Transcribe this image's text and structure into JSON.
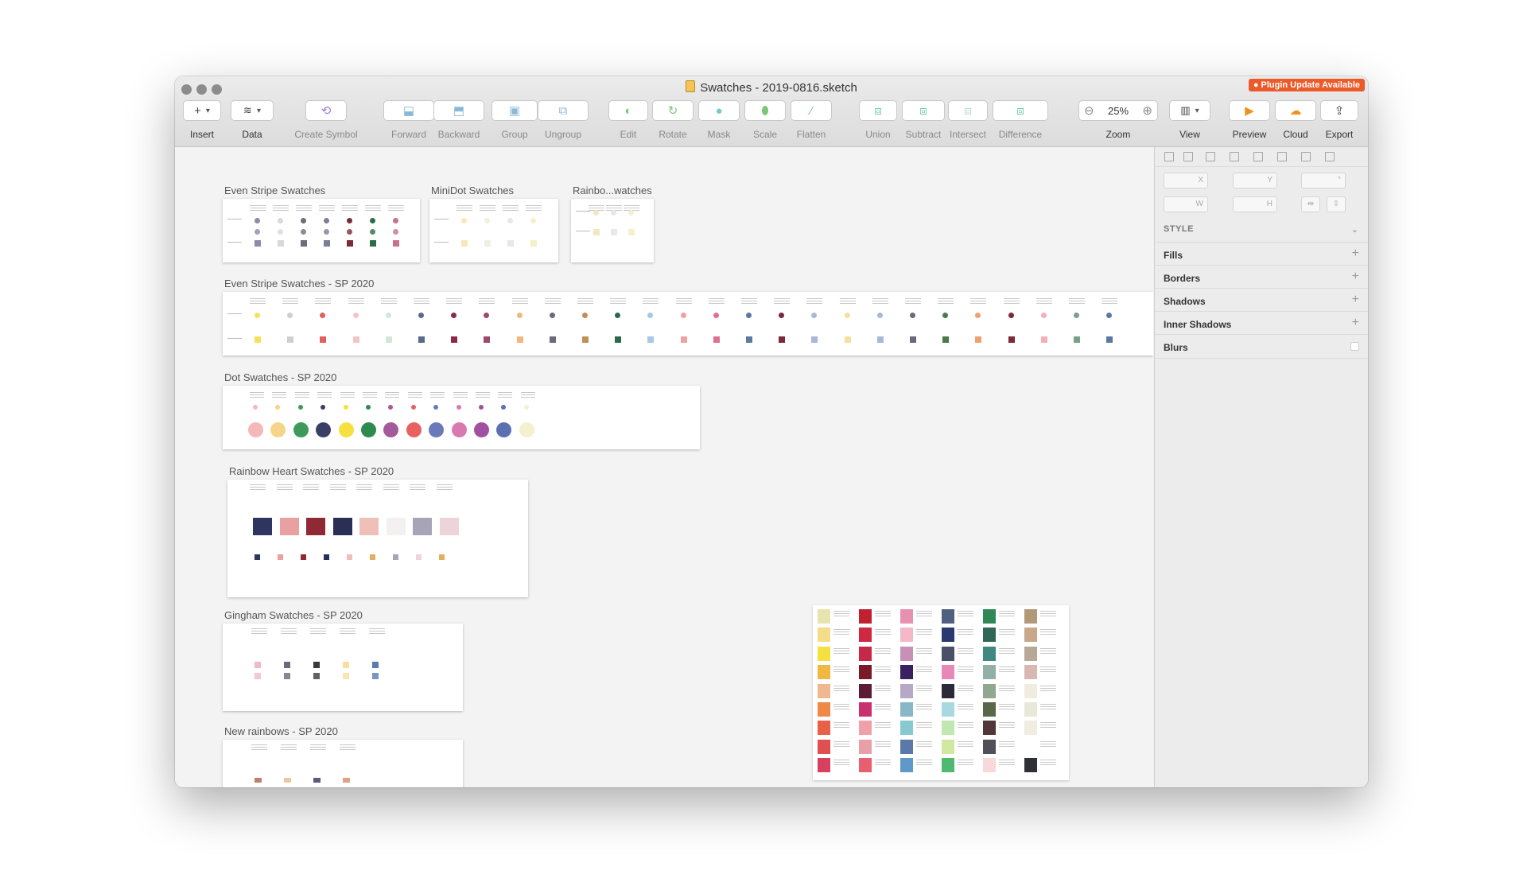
{
  "window": {
    "title": "Swatches - 2019-0816.sketch",
    "plugin_badge": "● Plugin Update Available"
  },
  "toolbar": {
    "insert": "Insert",
    "data": "Data",
    "create_symbol": "Create Symbol",
    "forward": "Forward",
    "backward": "Backward",
    "group": "Group",
    "ungroup": "Ungroup",
    "edit": "Edit",
    "rotate": "Rotate",
    "mask": "Mask",
    "scale": "Scale",
    "flatten": "Flatten",
    "union": "Union",
    "subtract": "Subtract",
    "intersect": "Intersect",
    "difference": "Difference",
    "zoom_label": "Zoom",
    "zoom_value": "25%",
    "view": "View",
    "preview": "Preview",
    "cloud": "Cloud",
    "export": "Export"
  },
  "artboards": {
    "even_stripe": "Even Stripe Swatches",
    "minidot": "MiniDot Swatches",
    "rainbo": "Rainbo...watches",
    "even_stripe_sp": "Even Stripe Swatches - SP 2020",
    "dot_sp": "Dot Swatches - SP 2020",
    "heart_sp": "Rainbow Heart Swatches - SP 2020",
    "gingham_sp": "Gingham Swatches - SP 2020",
    "new_rainbows": "New rainbows - SP 2020"
  },
  "inspector": {
    "x": "X",
    "y": "Y",
    "w": "W",
    "h": "H",
    "style": "STYLE",
    "fills": "Fills",
    "borders": "Borders",
    "shadows": "Shadows",
    "inner_shadows": "Inner Shadows",
    "blurs": "Blurs"
  },
  "colors": {
    "accent_orange": "#ec5a2a",
    "even_stripe": [
      "#8a8ca8",
      "#d8d8d8",
      "#6b6e7a",
      "#7b7f93",
      "#7a2a3a",
      "#2e6b4a",
      "#c9708a"
    ],
    "even_stripe_sp": [
      "#f6e05a",
      "#cfcfcf",
      "#e06060",
      "#f4c5c5",
      "#cfe8d8",
      "#5a6a8a",
      "#8a2a4a",
      "#9a4a6a",
      "#f0b880",
      "#6a6a7a",
      "#c0905a",
      "#2a6a4a",
      "#a8c8e8",
      "#f0a0a0",
      "#e07090",
      "#5a7aa0",
      "#7a2a3a",
      "#a8b8d8",
      "#f6e0a0",
      "#a8b8d8",
      "#6a6a7a",
      "#4a7a4a",
      "#f0a070",
      "#7a2a3a",
      "#f4b0b8",
      "#7aa08a",
      "#5a7aa0"
    ],
    "dot_sp": [
      "#f4b8b8",
      "#f6d488",
      "#3e9a5a",
      "#3a3f66",
      "#f6e040",
      "#2f8a50",
      "#a45a9a",
      "#e86060",
      "#6a7ab8",
      "#d87ab0",
      "#a050a0",
      "#5a70b0",
      "#f4f0d0"
    ],
    "heart_big": [
      "#2f3561",
      "#e8a0a0",
      "#8f2a35",
      "#2a2f55",
      "#f0c0b8",
      "#f4f0f0",
      "#a8a4b8",
      "#ecd4d8"
    ],
    "heart_small": [
      "#2f3561",
      "#e8a0a0",
      "#8f2a35",
      "#2a2f55",
      "#f0c0b8",
      "#e0b060",
      "#a8a4b8",
      "#ecd4d8",
      "#e0b060"
    ],
    "gingham": [
      "#f0b8c8",
      "#6a6a7a",
      "#3a3a3a",
      "#f6e0a0",
      "#5a7ab0"
    ],
    "palette_cols": [
      [
        "#e8e4b0",
        "#f6dc88",
        "#f6e040",
        "#f0b840",
        "#f0b890",
        "#f08848",
        "#e86048",
        "#e05050",
        "#d84060"
      ],
      [
        "#c02030",
        "#d02840",
        "#c82848",
        "#7a1a28",
        "#5a1a38",
        "#c83070",
        "#f0a0a8",
        "#e8a0a8",
        "#e86070"
      ],
      [
        "#e890b0",
        "#f4b8c8",
        "#c890b8",
        "#3a2060",
        "#b8a8c8",
        "#88b8c8",
        "#88c8d0",
        "#5a78a8",
        "#6098c8"
      ],
      [
        "#506080",
        "#2a3a70",
        "#4a5068",
        "#e888b8",
        "#2a2a3a",
        "#a8d8e0",
        "#c0e8b0",
        "#d0e8a0",
        "#50b870"
      ],
      [
        "#308858",
        "#306858",
        "#408880",
        "#90b0a8",
        "#90a890",
        "#586848",
        "#503838",
        "#505058",
        "#f8d8d8"
      ],
      [
        "#b09878",
        "#c8a888",
        "#b8a898",
        "#d8b8b0",
        "#f0ece0",
        "#e8e8d8",
        "#f0ece0",
        "#ffffff",
        "#303038"
      ]
    ]
  }
}
